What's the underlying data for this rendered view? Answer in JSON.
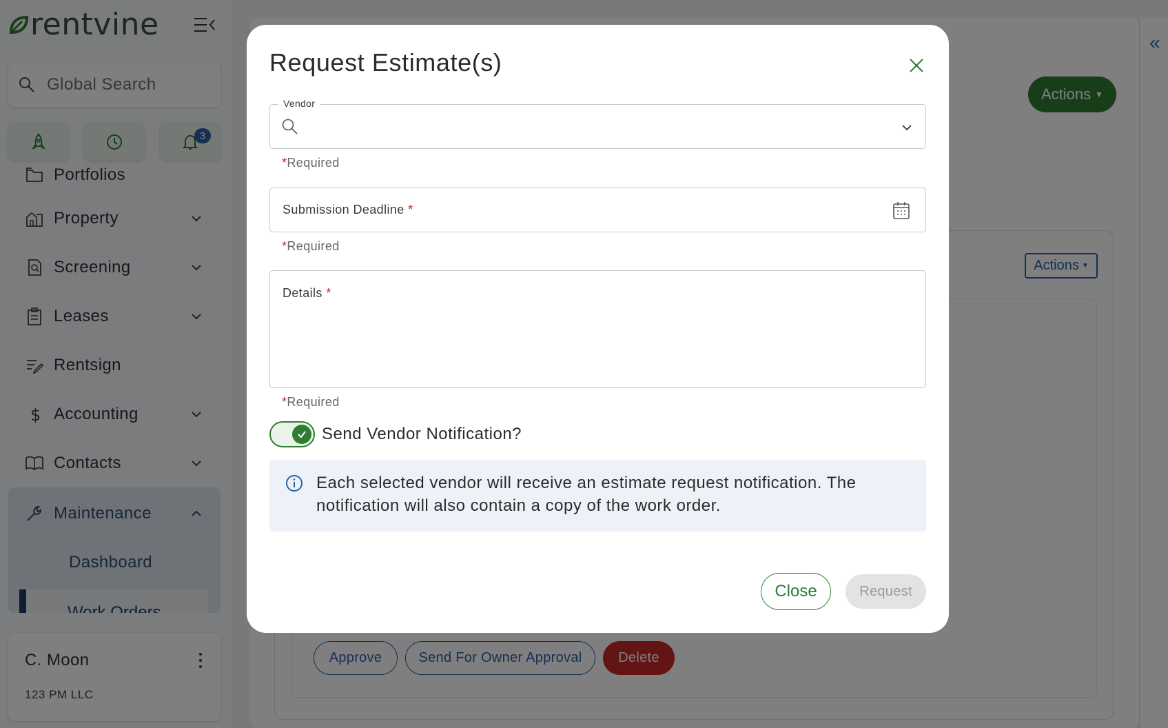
{
  "app": {
    "logo_text": "rentvine"
  },
  "sidebar": {
    "search_placeholder": "Global Search",
    "notification_count": "3",
    "items": [
      {
        "label": "Portfolios"
      },
      {
        "label": "Property"
      },
      {
        "label": "Screening"
      },
      {
        "label": "Leases"
      },
      {
        "label": "Rentsign"
      },
      {
        "label": "Accounting"
      },
      {
        "label": "Contacts"
      },
      {
        "label": "Maintenance"
      }
    ],
    "sub_items": [
      {
        "label": "Dashboard"
      },
      {
        "label": "Work Orders"
      }
    ],
    "user": {
      "name": "C. Moon",
      "org": "123 PM LLC"
    }
  },
  "background": {
    "actions_primary": "Actions",
    "actions_secondary": "Actions",
    "approve": "Approve",
    "send_owner_approval": "Send For Owner Approval",
    "delete": "Delete"
  },
  "modal": {
    "title": "Request Estimate(s)",
    "vendor": {
      "legend": "Vendor",
      "helper": "Required"
    },
    "deadline": {
      "label": "Submission Deadline",
      "helper": "Required"
    },
    "details": {
      "label": "Details",
      "helper": "Required"
    },
    "required_star": "*",
    "toggle_label": "Send Vendor Notification?",
    "toggle_on": true,
    "info": "Each selected vendor will receive an estimate request notification. The notification will also contain a copy of the work order.",
    "close_label": "Close",
    "request_label": "Request"
  },
  "colors": {
    "brand_green": "#2e7d32",
    "nav_blue": "#2c5fa8",
    "danger": "#c62828"
  }
}
